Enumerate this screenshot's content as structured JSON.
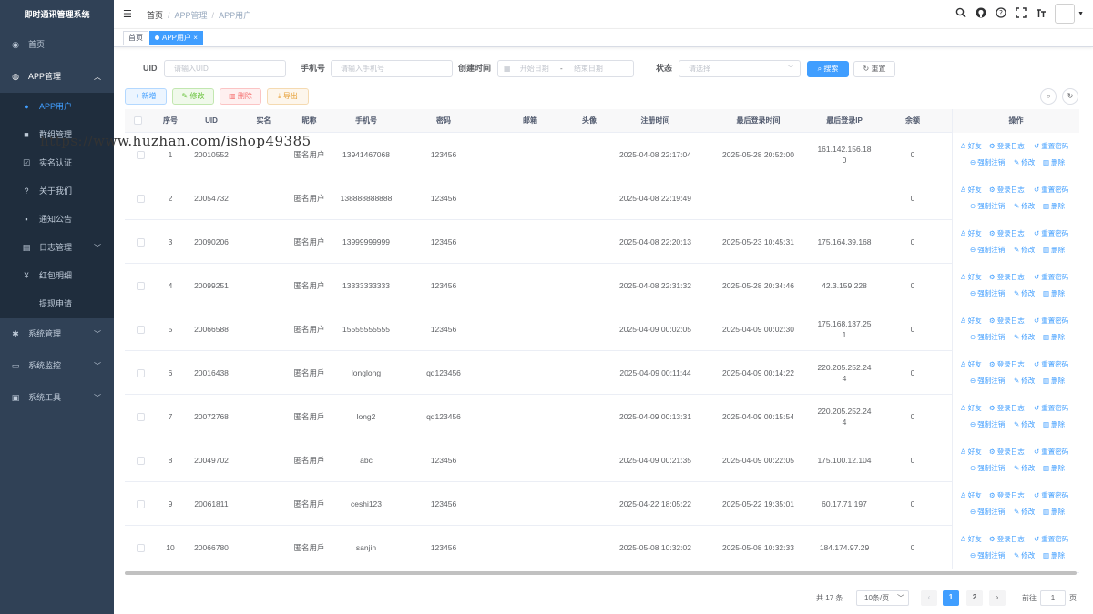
{
  "app": {
    "title": "即时通讯管理系统"
  },
  "sidebar": {
    "items": [
      {
        "icon": "dashboard-icon",
        "label": "首页"
      },
      {
        "icon": "globe-icon",
        "label": "APP管理"
      }
    ],
    "sub_items": [
      {
        "icon": "user-icon",
        "label": "APP用户"
      },
      {
        "icon": "group-icon",
        "label": "群组管理"
      },
      {
        "icon": "checkbox-icon",
        "label": "实名认证"
      },
      {
        "icon": "question-icon",
        "label": "关于我们"
      },
      {
        "icon": "message-icon",
        "label": "通知公告"
      },
      {
        "icon": "log-icon",
        "label": "日志管理"
      },
      {
        "icon": "yen-icon",
        "label": "红包明细"
      },
      {
        "icon": "withdraw-icon",
        "label": "提现申请"
      }
    ],
    "bottom_items": [
      {
        "icon": "gear-icon",
        "label": "系统管理"
      },
      {
        "icon": "monitor-icon",
        "label": "系统监控"
      },
      {
        "icon": "tool-icon",
        "label": "系统工具"
      }
    ]
  },
  "navbar": {
    "breadcrumb": [
      "首页",
      "APP管理",
      "APP用户"
    ]
  },
  "tags": {
    "home": "首页",
    "current": "APP用户"
  },
  "search": {
    "uid_label": "UID",
    "uid_placeholder": "请输入UID",
    "phone_label": "手机号",
    "phone_placeholder": "请输入手机号",
    "created_label": "创建时间",
    "start_placeholder": "开始日期",
    "range_sep": "-",
    "end_placeholder": "结束日期",
    "status_label": "状态",
    "status_placeholder": "请选择",
    "search_btn": "搜索",
    "reset_btn": "重置"
  },
  "toolbar": {
    "add": "新增",
    "edit": "修改",
    "delete": "删除",
    "export": "导出"
  },
  "table": {
    "columns": [
      "序号",
      "UID",
      "实名",
      "昵称",
      "手机号",
      "密码",
      "邮箱",
      "头像",
      "注册时间",
      "最后登录时间",
      "最后登录IP",
      "余额",
      "操作"
    ],
    "rows": [
      {
        "no": "1",
        "uid": "20010552",
        "realname": "",
        "nickname": "匿名用户",
        "phone": "13941467068",
        "password": "123456",
        "email": "",
        "avatar": "",
        "reg": "2025-04-08 22:17:04",
        "last": "2025-05-28 20:52:00",
        "ip": "161.142.156.18\n0",
        "balance": "0"
      },
      {
        "no": "2",
        "uid": "20054732",
        "realname": "",
        "nickname": "匿名用户",
        "phone": "138888888888",
        "password": "123456",
        "email": "",
        "avatar": "",
        "reg": "2025-04-08 22:19:49",
        "last": "",
        "ip": "",
        "balance": "0"
      },
      {
        "no": "3",
        "uid": "20090206",
        "realname": "",
        "nickname": "匿名用户",
        "phone": "13999999999",
        "password": "123456",
        "email": "",
        "avatar": "",
        "reg": "2025-04-08 22:20:13",
        "last": "2025-05-23 10:45:31",
        "ip": "175.164.39.168",
        "balance": "0"
      },
      {
        "no": "4",
        "uid": "20099251",
        "realname": "",
        "nickname": "匿名用户",
        "phone": "13333333333",
        "password": "123456",
        "email": "",
        "avatar": "",
        "reg": "2025-04-08 22:31:32",
        "last": "2025-05-28 20:34:46",
        "ip": "42.3.159.228",
        "balance": "0"
      },
      {
        "no": "5",
        "uid": "20066588",
        "realname": "",
        "nickname": "匿名用户",
        "phone": "15555555555",
        "password": "123456",
        "email": "",
        "avatar": "",
        "reg": "2025-04-09 00:02:05",
        "last": "2025-04-09 00:02:30",
        "ip": "175.168.137.25\n1",
        "balance": "0"
      },
      {
        "no": "6",
        "uid": "20016438",
        "realname": "",
        "nickname": "匿名用戶",
        "phone": "longlong",
        "password": "qq123456",
        "email": "",
        "avatar": "",
        "reg": "2025-04-09 00:11:44",
        "last": "2025-04-09 00:14:22",
        "ip": "220.205.252.24\n4",
        "balance": "0"
      },
      {
        "no": "7",
        "uid": "20072768",
        "realname": "",
        "nickname": "匿名用戶",
        "phone": "long2",
        "password": "qq123456",
        "email": "",
        "avatar": "",
        "reg": "2025-04-09 00:13:31",
        "last": "2025-04-09 00:15:54",
        "ip": "220.205.252.24\n4",
        "balance": "0"
      },
      {
        "no": "8",
        "uid": "20049702",
        "realname": "",
        "nickname": "匿名用戶",
        "phone": "abc",
        "password": "123456",
        "email": "",
        "avatar": "",
        "reg": "2025-04-09 00:21:35",
        "last": "2025-04-09 00:22:05",
        "ip": "175.100.12.104",
        "balance": "0"
      },
      {
        "no": "9",
        "uid": "20061811",
        "realname": "",
        "nickname": "匿名用戶",
        "phone": "ceshi123",
        "password": "123456",
        "email": "",
        "avatar": "",
        "reg": "2025-04-22 18:05:22",
        "last": "2025-05-22 19:35:01",
        "ip": "60.17.71.197",
        "balance": "0"
      },
      {
        "no": "10",
        "uid": "20066780",
        "realname": "",
        "nickname": "匿名用戶",
        "phone": "sanjin",
        "password": "123456",
        "email": "",
        "avatar": "",
        "reg": "2025-05-08 10:32:02",
        "last": "2025-05-08 10:32:33",
        "ip": "184.174.97.29",
        "balance": "0"
      }
    ],
    "row_actions": {
      "friends": "好友",
      "login_log": "登录日志",
      "reset_pwd": "重置密码",
      "force_logout": "强制注销",
      "edit": "修改",
      "delete": "删除"
    }
  },
  "pagination": {
    "total": "共 17 条",
    "page_size": "10条/页",
    "pages": [
      "1",
      "2"
    ],
    "current": "1",
    "goto_label": "前往",
    "goto_value": "1",
    "page_suffix": "页"
  },
  "watermark": "https://www.huzhan.com/ishop49385",
  "colors": {
    "sidebar_bg": "#304156",
    "accent": "#409eff",
    "sub_menu_bg": "#1f2d3d"
  }
}
